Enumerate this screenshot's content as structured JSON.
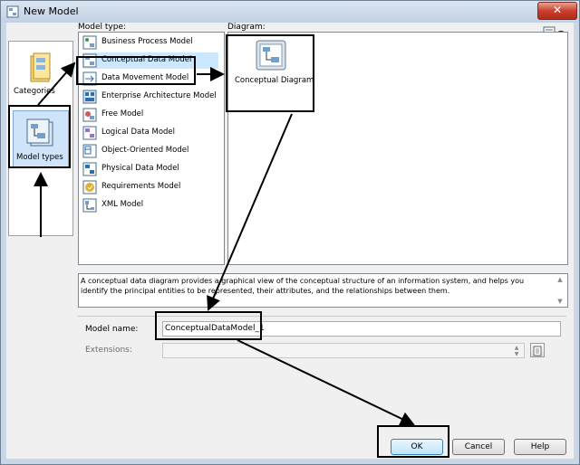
{
  "window": {
    "title": "New Model",
    "close_glyph": "✕"
  },
  "sidebar": {
    "items": [
      {
        "label": "Categories",
        "icon": "folder-icon"
      },
      {
        "label": "Model types",
        "icon": "model-types-icon"
      }
    ]
  },
  "model_type": {
    "label": "Model type:",
    "items": [
      {
        "label": "Business Process Model",
        "icon": "business-process-icon"
      },
      {
        "label": "Conceptual Data Model",
        "icon": "conceptual-data-icon",
        "selected": true
      },
      {
        "label": "Data Movement Model",
        "icon": "data-movement-icon"
      },
      {
        "label": "Enterprise Architecture Model",
        "icon": "enterprise-architecture-icon"
      },
      {
        "label": "Free Model",
        "icon": "free-model-icon"
      },
      {
        "label": "Logical Data Model",
        "icon": "logical-data-icon"
      },
      {
        "label": "Object-Oriented Model",
        "icon": "object-oriented-icon"
      },
      {
        "label": "Physical Data Model",
        "icon": "physical-data-icon"
      },
      {
        "label": "Requirements Model",
        "icon": "requirements-icon"
      },
      {
        "label": "XML Model",
        "icon": "xml-icon"
      }
    ]
  },
  "diagram": {
    "label": "Diagram:",
    "items": [
      {
        "label": "Conceptual Diagram",
        "icon": "conceptual-diagram-icon"
      }
    ]
  },
  "description": "A conceptual data diagram provides a graphical view of the conceptual structure of an information system, and helps you identify the principal entities to be represented, their attributes, and the relationships between them.",
  "form": {
    "model_name_label": "Model name:",
    "model_name_value": "ConceptualDataModel_1",
    "extensions_label": "Extensions:",
    "extensions_value": ""
  },
  "buttons": {
    "ok": "OK",
    "cancel": "Cancel",
    "help": "Help"
  },
  "colors": {
    "selection": "#cce8ff",
    "annotation": "#000000"
  }
}
